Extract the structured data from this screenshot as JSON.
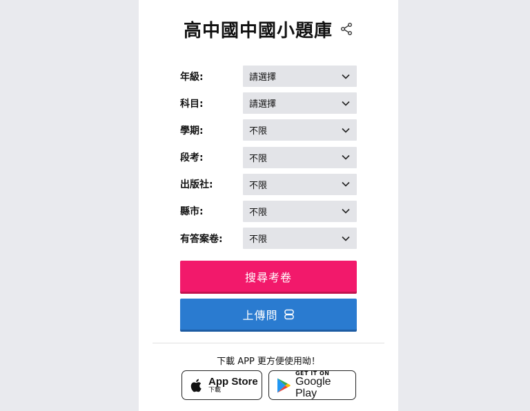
{
  "header": {
    "title": "高中國中國小題庫",
    "share_icon": "share-icon"
  },
  "form": {
    "fields": [
      {
        "label": "年級:",
        "value": "請選擇"
      },
      {
        "label": "科目:",
        "value": "請選擇"
      },
      {
        "label": "學期:",
        "value": "不限"
      },
      {
        "label": "段考:",
        "value": "不限"
      },
      {
        "label": "出版社:",
        "value": "不限"
      },
      {
        "label": "縣市:",
        "value": "不限"
      },
      {
        "label": "有答案卷:",
        "value": "不限"
      }
    ]
  },
  "buttons": {
    "search_label": "搜尋考卷",
    "upload_label": "上傳問",
    "search_color": "#f2196b",
    "upload_color": "#2a7bd0"
  },
  "app": {
    "download_text": "下載 APP 更方便使用呦！",
    "apple": {
      "name": "App Store",
      "sub": "下載"
    },
    "google": {
      "sub": "GET IT ON",
      "name": "Google Play"
    }
  }
}
